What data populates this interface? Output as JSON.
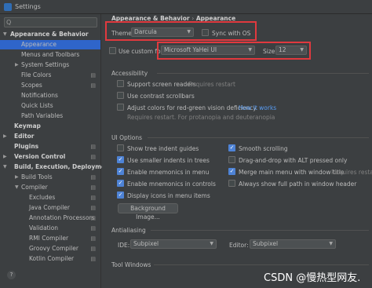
{
  "window": {
    "title": "Settings"
  },
  "sidebar": {
    "search_placeholder": "Q",
    "items": [
      {
        "label": "Appearance & Behavior",
        "expanded": true
      },
      {
        "label": "Appearance"
      },
      {
        "label": "Menus and Toolbars"
      },
      {
        "label": "System Settings"
      },
      {
        "label": "File Colors"
      },
      {
        "label": "Scopes"
      },
      {
        "label": "Notifications"
      },
      {
        "label": "Quick Lists"
      },
      {
        "label": "Path Variables"
      },
      {
        "label": "Keymap"
      },
      {
        "label": "Editor"
      },
      {
        "label": "Plugins"
      },
      {
        "label": "Version Control"
      },
      {
        "label": "Build, Execution, Deployment"
      },
      {
        "label": "Build Tools"
      },
      {
        "label": "Compiler"
      },
      {
        "label": "Excludes"
      },
      {
        "label": "Java Compiler"
      },
      {
        "label": "Annotation Processors"
      },
      {
        "label": "Validation"
      },
      {
        "label": "RMI Compiler"
      },
      {
        "label": "Groovy Compiler"
      },
      {
        "label": "Kotlin Compiler"
      }
    ],
    "help": "?"
  },
  "breadcrumb": {
    "parent": "Appearance & Behavior",
    "sep": "›",
    "current": "Appearance"
  },
  "theme": {
    "label": "Theme:",
    "value": "Darcula",
    "sync_label": "Sync with OS",
    "sync_checked": false
  },
  "font": {
    "use_custom_label": "Use custom font:",
    "use_custom_checked": false,
    "value": "Microsoft YaHei UI",
    "size_label": "Size:",
    "size_value": "12"
  },
  "accessibility": {
    "title": "Accessibility",
    "screen_readers": "Support screen readers",
    "requires_restart": "Requires restart",
    "contrast_scrollbars": "Use contrast scrollbars",
    "red_green": "Adjust colors for red-green vision deficiency",
    "how_it_works": "How it works",
    "red_green_note": "Requires restart. For protanopia and deuteranopia"
  },
  "ui_options": {
    "title": "UI Options",
    "tree_indent": "Show tree indent guides",
    "smaller_indents": "Use smaller indents in trees",
    "mnemonics_menu": "Enable mnemonics in menu",
    "mnemonics_controls": "Enable mnemonics in controls",
    "icons_menu": "Display icons in menu items",
    "smooth_scrolling": "Smooth scrolling",
    "drag_drop": "Drag-and-drop with ALT pressed only",
    "merge_menu": "Merge main menu with window title",
    "merge_requires": "Requires restart",
    "full_path": "Always show full path in window header",
    "background_image": "Background Image..."
  },
  "antialiasing": {
    "title": "Antialiasing",
    "ide_label": "IDE:",
    "ide_value": "Subpixel",
    "editor_label": "Editor:",
    "editor_value": "Subpixel"
  },
  "tool_windows": {
    "title": "Tool Windows"
  },
  "watermark": "CSDN @慢热型网友."
}
